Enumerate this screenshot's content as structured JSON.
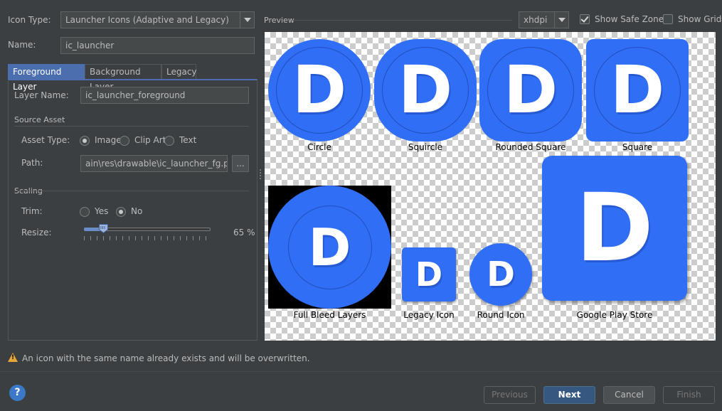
{
  "top": {
    "icon_type_label": "Icon Type:",
    "icon_type_value": "Launcher Icons (Adaptive and Legacy)",
    "name_label": "Name:",
    "name_value": "ic_launcher",
    "preview_label": "Preview",
    "density_value": "xhdpi",
    "show_safe_zone_label": "Show Safe Zone",
    "show_safe_zone_checked": true,
    "show_grid_label": "Show Grid",
    "show_grid_checked": false
  },
  "tabs": [
    {
      "label": "Foreground Layer",
      "active": true
    },
    {
      "label": "Background Layer",
      "active": false
    },
    {
      "label": "Legacy",
      "active": false
    }
  ],
  "form": {
    "layer_name_label": "Layer Name:",
    "layer_name_value": "ic_launcher_foreground",
    "source_asset_header": "Source Asset",
    "asset_type_label": "Asset Type:",
    "asset_type_options": [
      "Image",
      "Clip Art",
      "Text"
    ],
    "asset_type_selected": "Image",
    "path_label": "Path:",
    "path_value": "ain\\res\\drawable\\ic_launcher_fg.png",
    "browse_label": "...",
    "scaling_header": "Scaling",
    "trim_label": "Trim:",
    "trim_options": [
      "Yes",
      "No"
    ],
    "trim_selected": "No",
    "resize_label": "Resize:",
    "resize_value": 65,
    "resize_text": "65 %"
  },
  "preview": {
    "glyph": "D",
    "icon_color": "#2f6ef5",
    "captions": {
      "circle": "Circle",
      "squircle": "Squircle",
      "rounded_square": "Rounded Square",
      "square": "Square",
      "full_bleed": "Full Bleed Layers",
      "legacy": "Legacy Icon",
      "round": "Round Icon",
      "play_store": "Google Play Store"
    }
  },
  "warning_text": "An icon with the same name already exists and will be overwritten.",
  "buttons": {
    "help": "?",
    "previous": "Previous",
    "next": "Next",
    "cancel": "Cancel",
    "finish": "Finish"
  },
  "colors": {
    "accent": "#4b6eaf",
    "warning": "#e2a63a"
  }
}
